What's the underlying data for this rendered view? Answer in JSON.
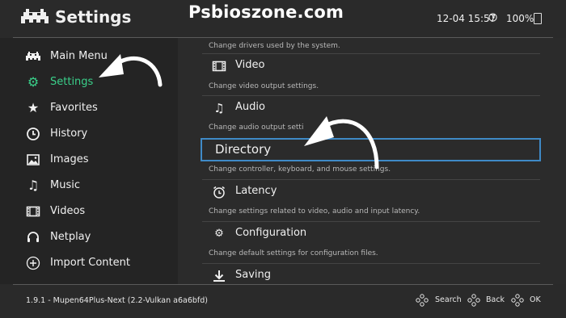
{
  "header": {
    "title": "Settings",
    "watermark": "Psbioszone.com",
    "datetime": "12-04 15:57",
    "battery": "100%"
  },
  "sidebar": {
    "items": [
      {
        "label": "Main Menu",
        "icon": "invader-icon",
        "active": false
      },
      {
        "label": "Settings",
        "icon": "gear-icon",
        "active": true
      },
      {
        "label": "Favorites",
        "icon": "star-icon",
        "active": false
      },
      {
        "label": "History",
        "icon": "history-icon",
        "active": false
      },
      {
        "label": "Images",
        "icon": "image-icon",
        "active": false
      },
      {
        "label": "Music",
        "icon": "music-icon",
        "active": false
      },
      {
        "label": "Videos",
        "icon": "film-icon",
        "active": false
      },
      {
        "label": "Netplay",
        "icon": "headset-icon",
        "active": false
      },
      {
        "label": "Import Content",
        "icon": "plus-icon",
        "active": false
      }
    ]
  },
  "main": {
    "top_sublabel": "Change drivers used by the system.",
    "entries": [
      {
        "label": "Video",
        "icon": "film-icon",
        "sublabel": "Change video output settings."
      },
      {
        "label": "Audio",
        "icon": "music-icon",
        "sublabel": "Change audio output setti"
      },
      {
        "label": "Directory",
        "icon": "",
        "sublabel": "Change controller, keyboard, and mouse settings.",
        "selected": true
      },
      {
        "label": "Latency",
        "icon": "alarm-icon",
        "sublabel": "Change settings related to video, audio and input latency."
      },
      {
        "label": "Configuration",
        "icon": "gears-icon",
        "sublabel": "Change default settings for configuration files."
      },
      {
        "label": "Saving",
        "icon": "download-icon",
        "sublabel": ""
      }
    ]
  },
  "footer": {
    "version": "1.9.1 - Mupen64Plus-Next (2.2-Vulkan a6a6bfd)",
    "search": "Search",
    "back": "Back",
    "ok": "OK"
  },
  "colors": {
    "accent": "#3ad08a",
    "selection_border": "#3f8ac7",
    "background": "#2a2a2a"
  }
}
